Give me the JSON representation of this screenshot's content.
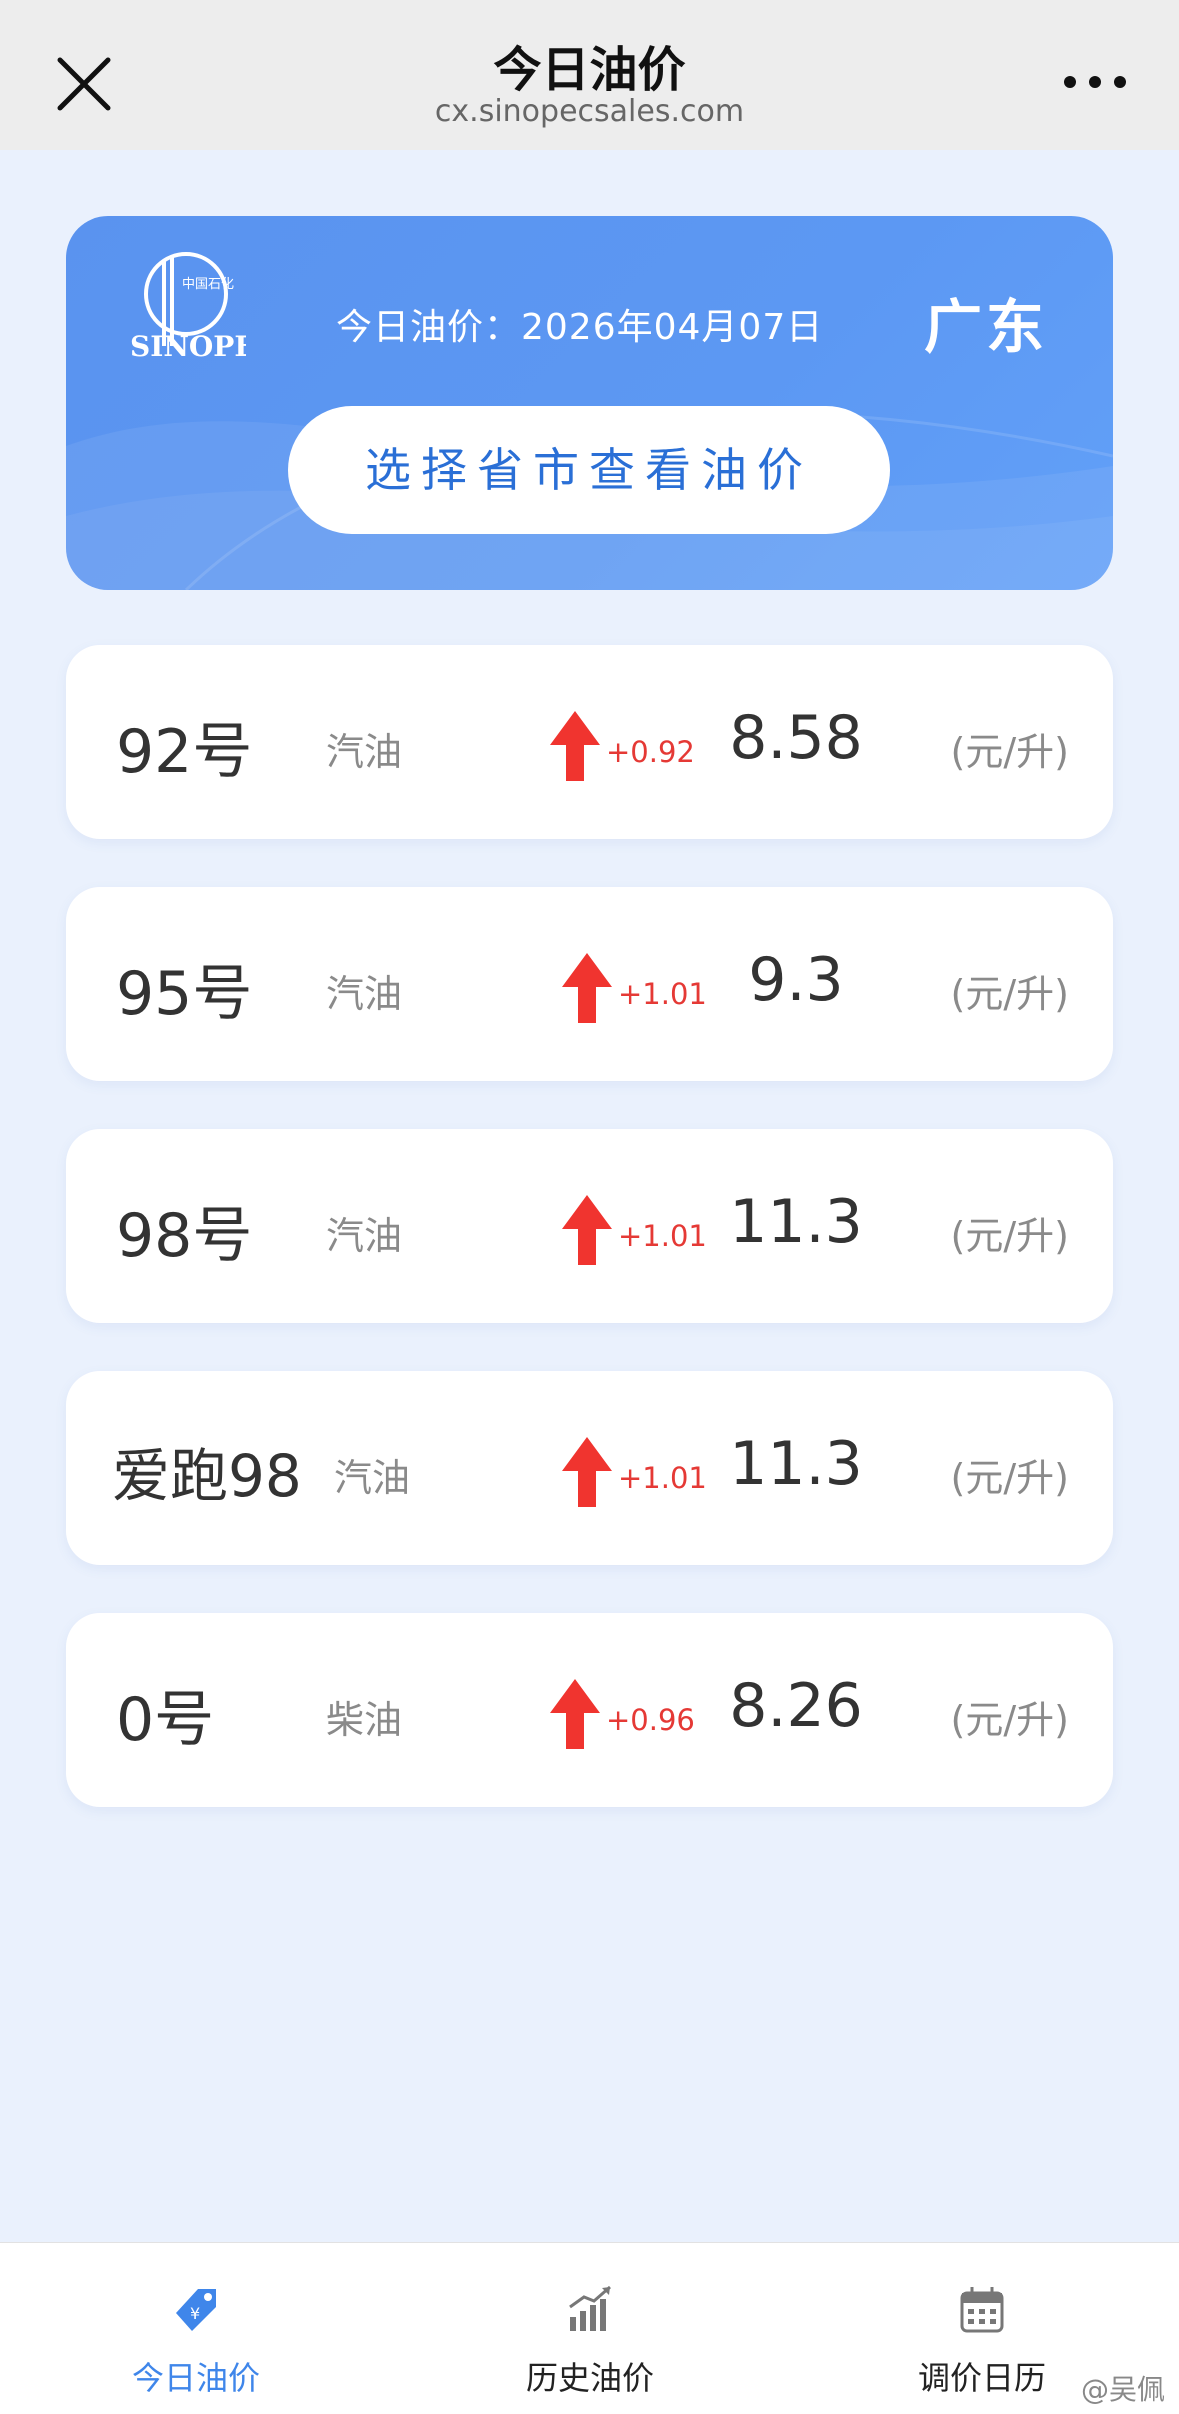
{
  "nav": {
    "title": "今日油价",
    "url": "cx.sinopecsales.com"
  },
  "header": {
    "logo_text": "SINOPEC 中国石化",
    "date_label": "今日油价：2026年04月07日",
    "province": "广东",
    "select_button": "选择省市查看油价"
  },
  "prices": [
    {
      "grade": "92号",
      "kind": "汽油",
      "change": "+0.92",
      "price": "8.58",
      "unit": "(元/升)"
    },
    {
      "grade": "95号",
      "kind": "汽油",
      "change": "+1.01",
      "price": "9.3",
      "unit": "(元/升)"
    },
    {
      "grade": "98号",
      "kind": "汽油",
      "change": "+1.01",
      "price": "11.3",
      "unit": "(元/升)"
    },
    {
      "grade": "爱跑98",
      "kind": "汽油",
      "change": "+1.01",
      "price": "11.3",
      "unit": "(元/升)"
    },
    {
      "grade": "0号",
      "kind": "柴油",
      "change": "+0.96",
      "price": "8.26",
      "unit": "(元/升)"
    }
  ],
  "tabs": [
    {
      "label": "今日油价",
      "icon": "tag-icon",
      "active": true
    },
    {
      "label": "历史油价",
      "icon": "bar-chart-icon",
      "active": false
    },
    {
      "label": "调价日历",
      "icon": "calendar-icon",
      "active": false
    }
  ],
  "watermark": "@吴佩",
  "colors": {
    "accent": "#3f86ea",
    "hero": "#5c98f3",
    "background": "#eaf1fd",
    "increase": "#e53935"
  }
}
